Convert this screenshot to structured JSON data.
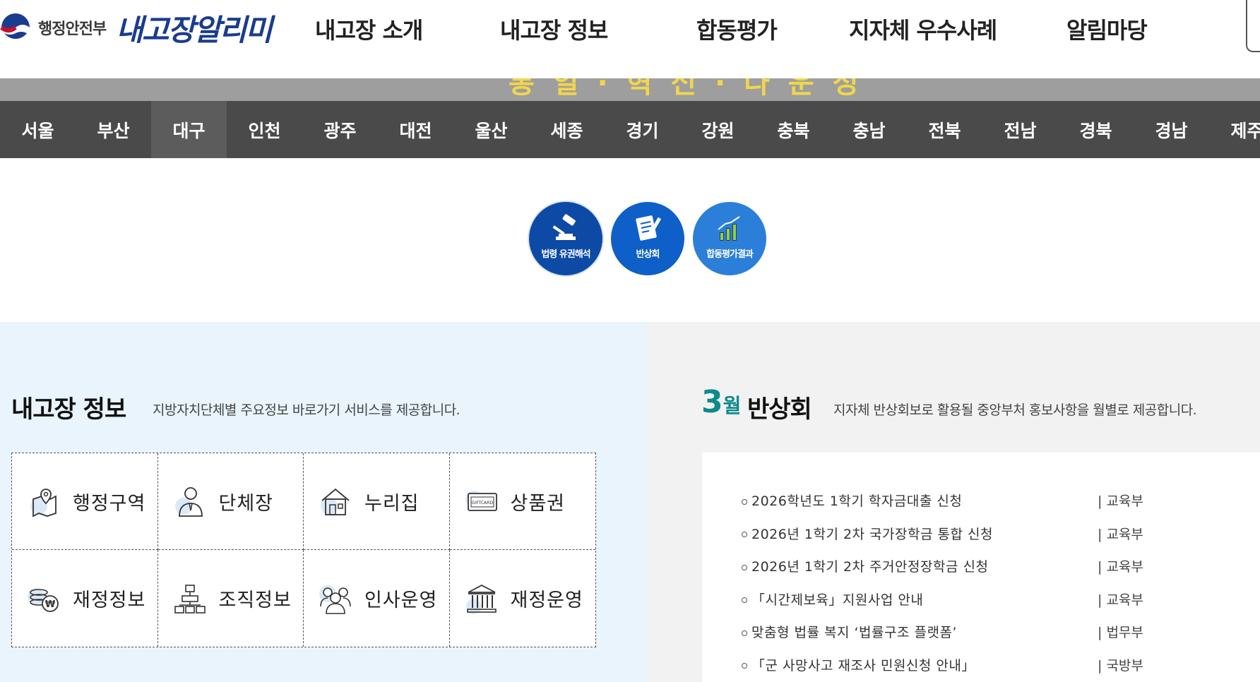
{
  "header": {
    "ministry": "행정안전부",
    "brand": "내고장알리미",
    "menu": [
      "내고장 소개",
      "내고장 정보",
      "합동평가",
      "지자체 우수사례",
      "알림마당"
    ]
  },
  "banner": {
    "text": "통 일 · 혁 신 · 다 운 성"
  },
  "regions": [
    "서울",
    "부산",
    "대구",
    "인천",
    "광주",
    "대전",
    "울산",
    "세종",
    "경기",
    "강원",
    "충북",
    "충남",
    "전북",
    "전남",
    "경북",
    "경남",
    "제주"
  ],
  "active_region": "대구",
  "quick": [
    {
      "label": "법령 유권해석",
      "icon": "gavel-icon"
    },
    {
      "label": "반상회",
      "icon": "document-pen-icon"
    },
    {
      "label": "합동평가결과",
      "icon": "bar-chart-icon"
    }
  ],
  "info": {
    "title": "내고장 정보",
    "desc": "지방자치단체별 주요정보 바로가기 서비스를 제공합니다.",
    "items": [
      {
        "label": "행정구역",
        "icon": "map-pin-icon"
      },
      {
        "label": "단체장",
        "icon": "person-icon"
      },
      {
        "label": "누리집",
        "icon": "house-icon"
      },
      {
        "label": "상품권",
        "icon": "gift-card-icon"
      },
      {
        "label": "재정정보",
        "icon": "won-coins-icon"
      },
      {
        "label": "조직정보",
        "icon": "org-chart-icon"
      },
      {
        "label": "인사운영",
        "icon": "people-icon"
      },
      {
        "label": "재정운영",
        "icon": "building-icon"
      }
    ]
  },
  "banhoe": {
    "month": "3",
    "month_suffix": "월",
    "title": "반상회",
    "desc": "지자체 반상회보로 활용될 중앙부처 홍보사항을 월별로 제공합니다.",
    "items": [
      {
        "title": "2026학년도 1학기 학자금대출 신청",
        "org": "| 교육부"
      },
      {
        "title": "2026년 1학기 2차 국가장학금 통합 신청",
        "org": "| 교육부"
      },
      {
        "title": "2026년 1학기 2차 주거안정장학금 신청",
        "org": "| 교육부"
      },
      {
        "title": "「시간제보육」지원사업 안내",
        "org": "| 교육부"
      },
      {
        "title": "맞춤형 법률 복지 ‘법률구조 플랫폼’",
        "org": "| 법무부"
      },
      {
        "title": "「군 사망사고 재조사 민원신청 안내」",
        "org": "| 국방부"
      }
    ]
  }
}
